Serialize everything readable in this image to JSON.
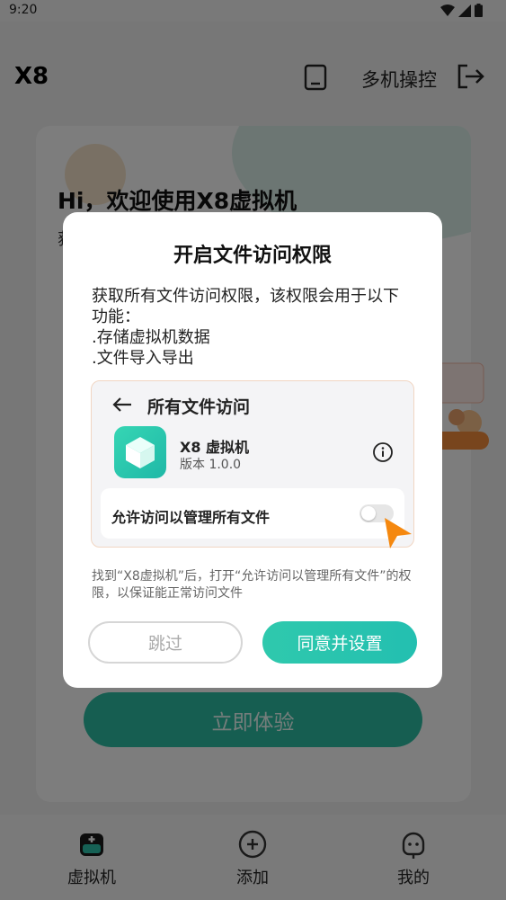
{
  "status_bar": {
    "time": "9:20"
  },
  "header": {
    "title": "X8",
    "multi_control_label": "多机操控"
  },
  "background": {
    "welcome_title": "Hi，欢迎使用X8虚拟机",
    "welcome_sub_visible": "获",
    "try_button": "立即体验"
  },
  "bottom_nav": {
    "items": [
      {
        "label": "虚拟机",
        "active": true
      },
      {
        "label": "添加",
        "active": false
      },
      {
        "label": "我的",
        "active": false
      }
    ]
  },
  "dialog": {
    "title": "开启文件访问权限",
    "body_lines": [
      "获取所有文件访问权限，该权限会用于以下",
      "功能：",
      ".存储虚拟机数据",
      ".文件导入导出"
    ],
    "preview": {
      "title": "所有文件访问",
      "app_name": "X8 虚拟机",
      "version": "版本 1.0.0",
      "toggle_label": "允许访问以管理所有文件",
      "toggle_on": false
    },
    "note": "找到“X8虚拟机”后，打开“允许访问以管理所有文件”的权限，以保证能正常访问文件",
    "skip_button": "跳过",
    "agree_button": "同意并设置"
  },
  "colors": {
    "accent": "#2cc3ab",
    "overlay": "rgba(0,0,0,0.5)",
    "cursor": "#f5880f"
  }
}
